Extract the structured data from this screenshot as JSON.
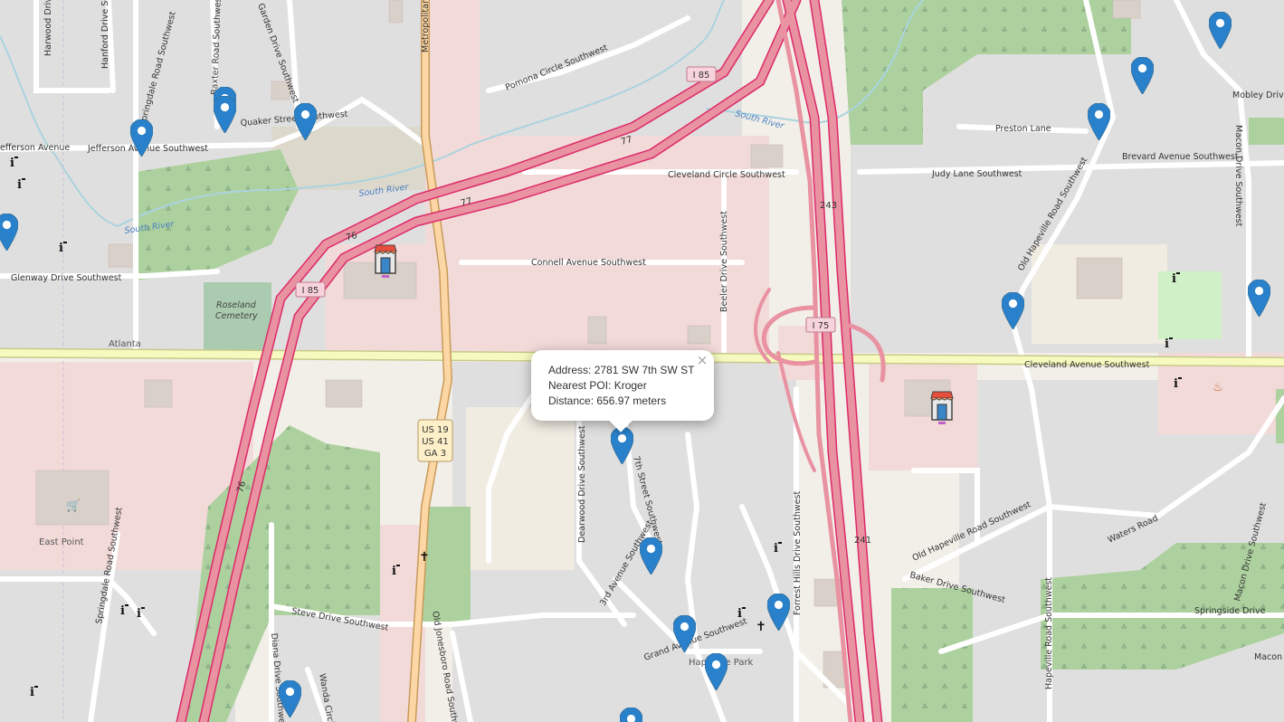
{
  "popup": {
    "address": "Address: 2781 SW 7th SW ST",
    "poi": "Nearest POI: Kroger",
    "distance": "Distance: 656.97 meters",
    "close_glyph": "×"
  },
  "street_labels": [
    "Harwood Drive Southwest",
    "Hanford Drive Southwest",
    "Baxter Road Southwest",
    "Garden Drive Southwest",
    "Springdale Road Southwest",
    "Quaker Street Southwest",
    "Jefferson Avenue Southwest",
    "efferson Avenue",
    "Metropolitan Parkway Southwest",
    "Pomona Circle Southwest",
    "Cleveland Circle Southwest",
    "Connell Avenue Southwest",
    "Beeler Drive Southwest",
    "Glenway Drive Southwest",
    "Preston Lane",
    "Judy Lane Southwest",
    "Brevard Avenue Southwest",
    "Mobley Drive",
    "Macon Drive Southwest",
    "Old Hapeville Road Southwest",
    "Cleveland Avenue Southwest",
    "Dearwood Drive Southwest",
    "7th Street Southwest",
    "3rd Avenue Southwest",
    "Grand Avenue Southwest",
    "Forrest Hills Drive Southwest",
    "Steve Drive Southwest",
    "Diana Drive Southwest",
    "Wanda Circle",
    "Old Jonesboro Road Southwest",
    "Springdale Road Southwest",
    "Old Hapeville Road Southwest",
    "Waters Road",
    "Baker Drive Southwest",
    "Hapeville Road Southwest",
    "Springside Drive",
    "Macon Drive Southwest",
    "Macon D"
  ],
  "water_labels": [
    "South River",
    "South River",
    "South River"
  ],
  "place_labels": [
    "Atlanta",
    "East Point",
    "Hapeville Park"
  ],
  "park_labels": [
    "Roseland",
    "Cemetery"
  ],
  "highway_shields": {
    "i85_top": "I 85",
    "i85_left": "I 85",
    "i75": "I 75",
    "us19": "US 19",
    "us41": "US 41",
    "ga3": "GA 3",
    "r77a": "77",
    "r77b": "77",
    "r76a": "76",
    "r76b": "76",
    "r243": "243",
    "r241": "241"
  },
  "colors": {
    "land": "#f2efe9",
    "residential": "#e0dfdf",
    "commercial": "#f2dad9",
    "park": "#add19e",
    "water": "#aad3df",
    "motorway": "#e892a2",
    "motorway_casing": "#dc2a67",
    "trunk": "#fcd6a4",
    "primary": "#f7fabf",
    "building": "#d9d0c9",
    "marker": "#2a81cb"
  },
  "markers": [
    {
      "name": "marker-1",
      "icon": "map-pin-icon"
    },
    {
      "name": "marker-2",
      "icon": "map-pin-icon"
    }
  ]
}
